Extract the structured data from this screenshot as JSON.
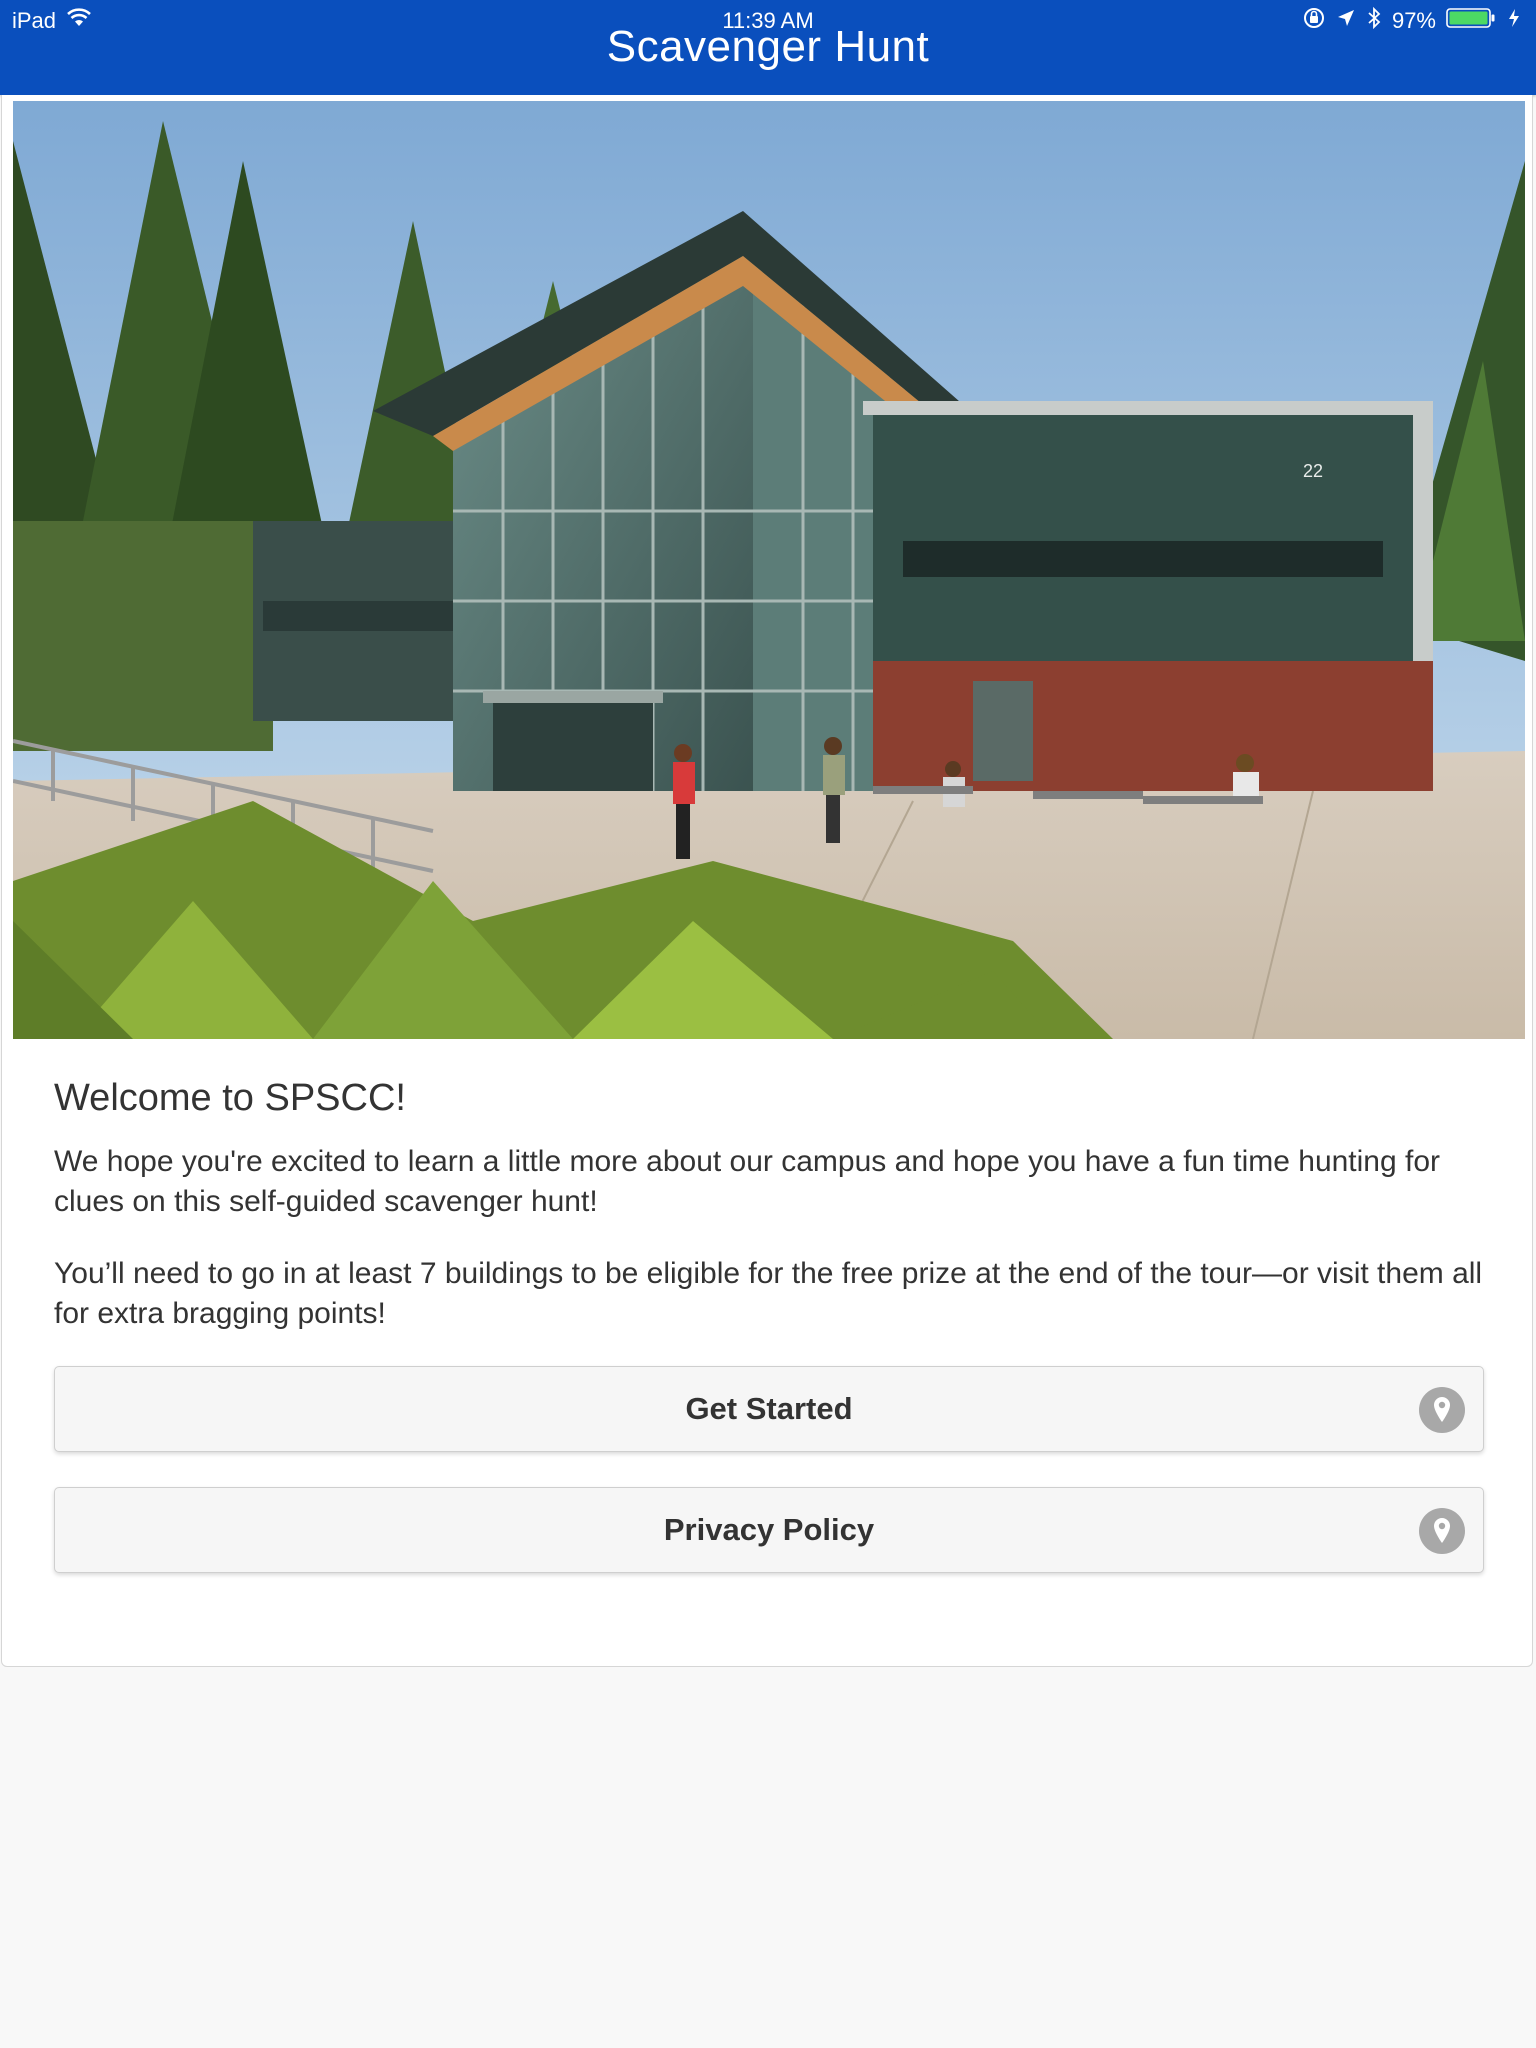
{
  "status_bar": {
    "device": "iPad",
    "time": "11:39 AM",
    "battery": "97%"
  },
  "nav": {
    "title": "Scavenger Hunt"
  },
  "hero": {
    "building_number": "22"
  },
  "main": {
    "heading": "Welcome to SPSCC!",
    "paragraph_1": "We hope you're excited to learn a little more about our campus and hope you have a fun time hunting for clues on this self-guided scavenger hunt!",
    "paragraph_2": "You’ll need to go in at least 7 buildings to be eligible for the free prize at the end of the tour—or visit them all for extra bragging points!",
    "buttons": [
      {
        "label": "Get Started",
        "icon": "map-pin-icon"
      },
      {
        "label": "Privacy Policy",
        "icon": "map-pin-icon"
      }
    ]
  },
  "colors": {
    "nav_bar": "#0a4fbd",
    "battery": "#4cd964",
    "button_bg": "#f6f6f6",
    "icon_bg": "#a8a8a8"
  }
}
